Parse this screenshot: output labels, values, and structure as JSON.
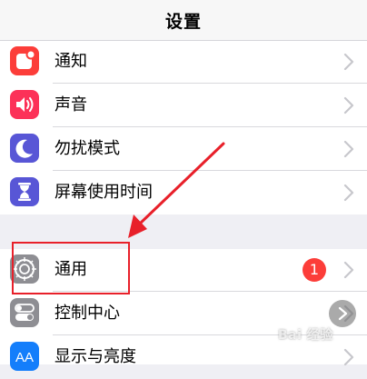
{
  "header": {
    "title": "设置"
  },
  "group1": [
    {
      "label": "通知",
      "icon": "notifications-icon",
      "color": "#fc3d39"
    },
    {
      "label": "声音",
      "icon": "sounds-icon",
      "color": "#fc3158"
    },
    {
      "label": "勿扰模式",
      "icon": "do-not-disturb-moon-icon",
      "color": "#5856d6"
    },
    {
      "label": "屏幕使用时间",
      "icon": "screen-time-hourglass-icon",
      "color": "#5856d6"
    }
  ],
  "group2": [
    {
      "label": "通用",
      "icon": "general-gear-icon",
      "color": "#8e8e93",
      "badge": "1"
    },
    {
      "label": "控制中心",
      "icon": "control-center-icon",
      "color": "#8e8e93"
    },
    {
      "label": "显示与亮度",
      "icon": "display-brightness-icon",
      "color": "#147efb"
    }
  ],
  "annotation": {
    "highlight_color": "#e8202a"
  },
  "watermark": {
    "text": "Bai 经验"
  }
}
